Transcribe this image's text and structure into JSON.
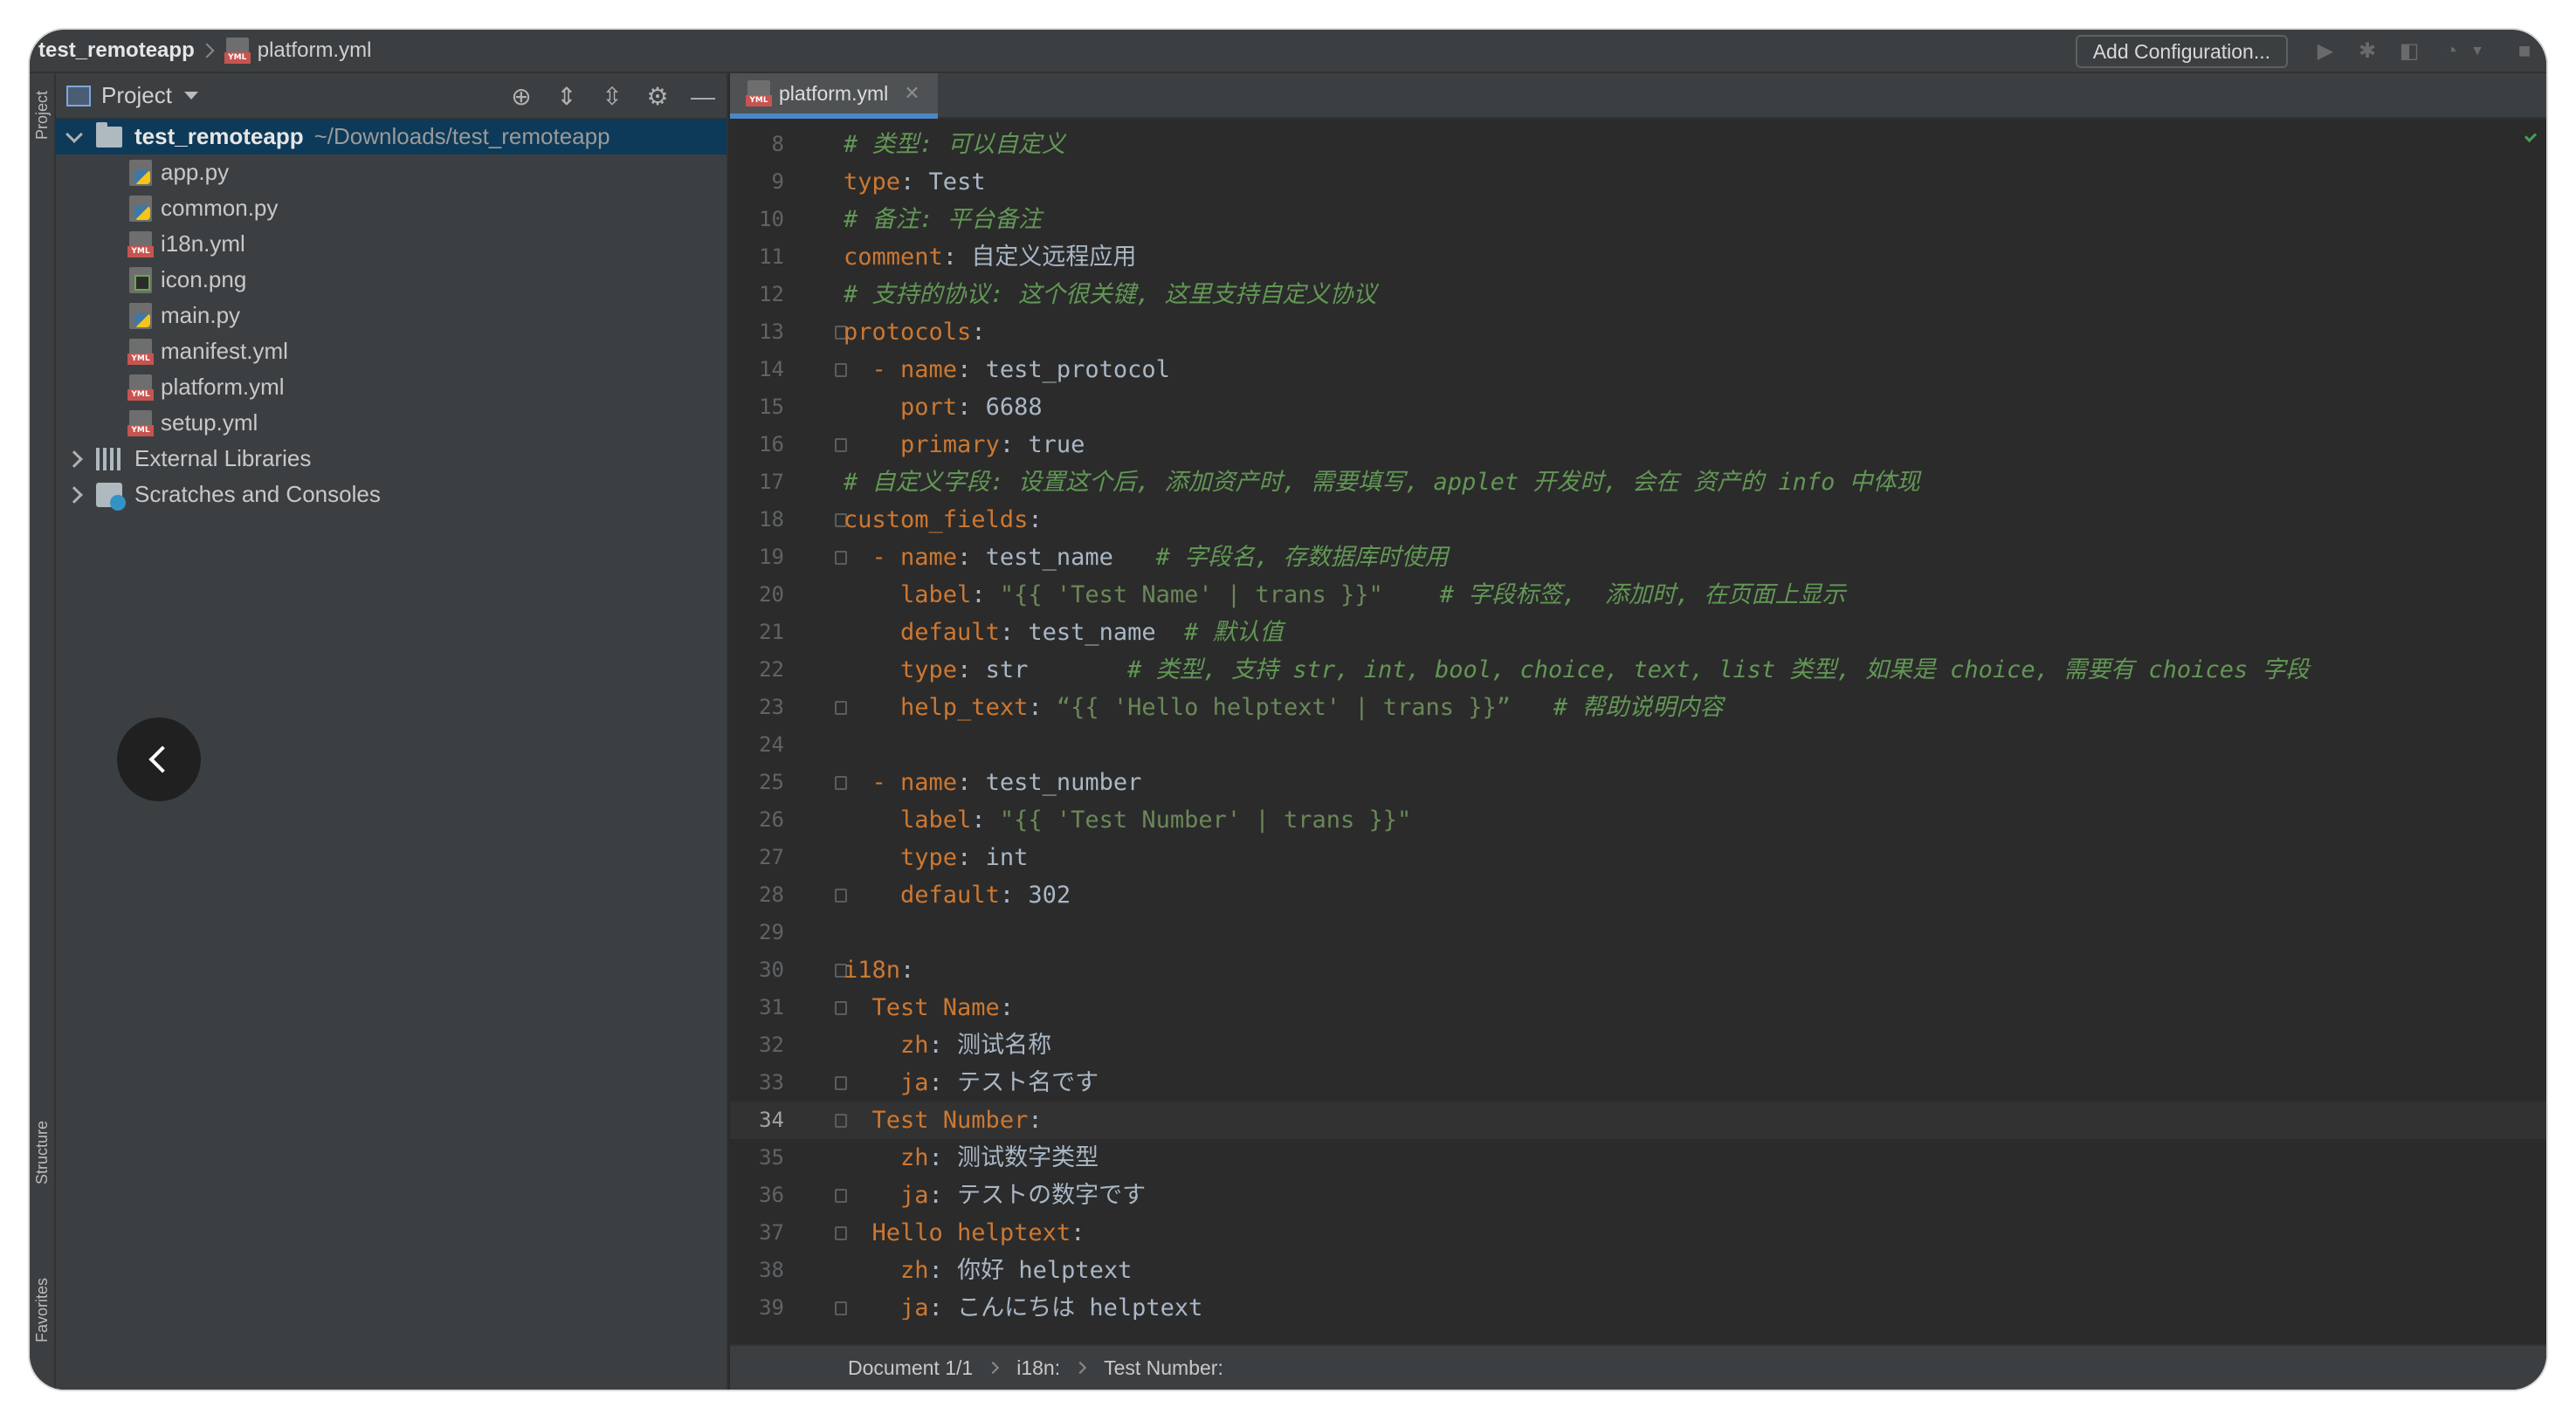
{
  "titlebar": {
    "project_name": "test_remoteapp",
    "file_name": "platform.yml",
    "add_configuration_label": "Add Configuration..."
  },
  "toolstrip": {
    "project_label": "Project",
    "structure_label": "Structure",
    "favorites_label": "Favorites"
  },
  "project_panel": {
    "title": "Project",
    "root": {
      "name": "test_remoteapp",
      "path": "~/Downloads/test_remoteapp"
    },
    "files": [
      {
        "name": "app.py",
        "icon": "python-file-icon"
      },
      {
        "name": "common.py",
        "icon": "python-file-icon"
      },
      {
        "name": "i18n.yml",
        "icon": "yaml-file-icon"
      },
      {
        "name": "icon.png",
        "icon": "image-file-icon"
      },
      {
        "name": "main.py",
        "icon": "python-file-icon"
      },
      {
        "name": "manifest.yml",
        "icon": "yaml-file-icon"
      },
      {
        "name": "platform.yml",
        "icon": "yaml-file-icon"
      },
      {
        "name": "setup.yml",
        "icon": "yaml-file-icon"
      }
    ],
    "external_libraries": "External Libraries",
    "scratches": "Scratches and Consoles"
  },
  "editor": {
    "tab_label": "platform.yml",
    "current_line": 34,
    "lines": [
      {
        "n": 8,
        "text": "# 类型: 可以自定义"
      },
      {
        "n": 9,
        "text": "type: Test"
      },
      {
        "n": 10,
        "text": "# 备注: 平台备注"
      },
      {
        "n": 11,
        "text": "comment: 自定义远程应用"
      },
      {
        "n": 12,
        "text": "# 支持的协议: 这个很关键, 这里支持自定义协议"
      },
      {
        "n": 13,
        "text": "protocols:"
      },
      {
        "n": 14,
        "text": "  - name: test_protocol"
      },
      {
        "n": 15,
        "text": "    port: 6688"
      },
      {
        "n": 16,
        "text": "    primary: true"
      },
      {
        "n": 17,
        "text": "# 自定义字段: 设置这个后, 添加资产时, 需要填写, applet 开发时, 会在 资产的 info 中体现"
      },
      {
        "n": 18,
        "text": "custom_fields:"
      },
      {
        "n": 19,
        "text": "  - name: test_name   # 字段名, 存数据库时使用"
      },
      {
        "n": 20,
        "text": "    label: \"{{ 'Test Name' | trans }}\"    # 字段标签,  添加时, 在页面上显示"
      },
      {
        "n": 21,
        "text": "    default: test_name  # 默认值"
      },
      {
        "n": 22,
        "text": "    type: str       # 类型, 支持 str, int, bool, choice, text, list 类型, 如果是 choice, 需要有 choices 字段"
      },
      {
        "n": 23,
        "text": "    help_text: “{{ 'Hello helptext' | trans }}”   # 帮助说明内容"
      },
      {
        "n": 24,
        "text": ""
      },
      {
        "n": 25,
        "text": "  - name: test_number"
      },
      {
        "n": 26,
        "text": "    label: \"{{ 'Test Number' | trans }}\""
      },
      {
        "n": 27,
        "text": "    type: int"
      },
      {
        "n": 28,
        "text": "    default: 302"
      },
      {
        "n": 29,
        "text": ""
      },
      {
        "n": 30,
        "text": "i18n:"
      },
      {
        "n": 31,
        "text": "  Test Name:"
      },
      {
        "n": 32,
        "text": "    zh: 测试名称"
      },
      {
        "n": 33,
        "text": "    ja: テスト名です"
      },
      {
        "n": 34,
        "text": "  Test Number:"
      },
      {
        "n": 35,
        "text": "    zh: 测试数字类型"
      },
      {
        "n": 36,
        "text": "    ja: テストの数字です"
      },
      {
        "n": 37,
        "text": "  Hello helptext:"
      },
      {
        "n": 38,
        "text": "    zh: 你好 helptext"
      },
      {
        "n": 39,
        "text": "    ja: こんにちは helptext"
      }
    ]
  },
  "statusbar": {
    "crumbs": [
      "Document 1/1",
      "i18n:",
      "Test Number:"
    ]
  },
  "colors": {
    "background": "#2b2b2b",
    "panel": "#3c3f41",
    "key": "#cc7832",
    "comment": "#629755",
    "string": "#6a8759",
    "selection": "#0d3a58",
    "tab_underline": "#4a88c7"
  }
}
